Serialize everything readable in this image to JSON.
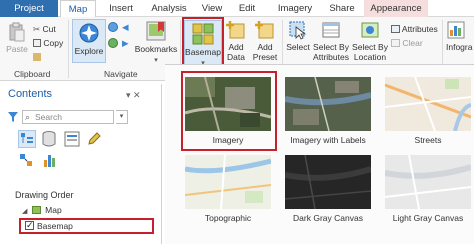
{
  "tabs": [
    {
      "label": "Project"
    },
    {
      "label": "Map"
    },
    {
      "label": "Insert"
    },
    {
      "label": "Analysis"
    },
    {
      "label": "View"
    },
    {
      "label": "Edit"
    },
    {
      "label": "Imagery"
    },
    {
      "label": "Share"
    },
    {
      "label": "Appearance"
    }
  ],
  "ribbon": {
    "clipboard": {
      "group_label": "Clipboard",
      "paste": "Paste",
      "cut": "Cut",
      "copy": "Copy"
    },
    "navigate": {
      "group_label": "Navigate",
      "explore": "Explore",
      "bookmarks": "Bookmarks"
    },
    "layer": {
      "basemap": "Basemap",
      "add_data_1": "Add",
      "add_data_2": "Data",
      "add_preset_1": "Add",
      "add_preset_2": "Preset"
    },
    "selection": {
      "select": "Select",
      "select_by_attr_1": "Select By",
      "select_by_attr_2": "Attributes",
      "select_by_loc_1": "Select By",
      "select_by_loc_2": "Location",
      "attributes": "Attributes",
      "clear": "Clear"
    },
    "inquiry": {
      "infographics": "Infogra"
    }
  },
  "contents": {
    "title": "Contents",
    "search_placeholder": "Search",
    "drawing_order": "Drawing Order",
    "tree": {
      "map": "Map",
      "basemap": "Basemap"
    }
  },
  "gallery": {
    "items": [
      {
        "label": "Imagery",
        "selected": true
      },
      {
        "label": "Imagery with Labels"
      },
      {
        "label": "Streets"
      },
      {
        "label": "Topographic"
      },
      {
        "label": "Dark Gray Canvas"
      },
      {
        "label": "Light Gray Canvas"
      }
    ]
  },
  "colors": {
    "accent": "#2f6fb0",
    "highlight": "#c8202b"
  }
}
